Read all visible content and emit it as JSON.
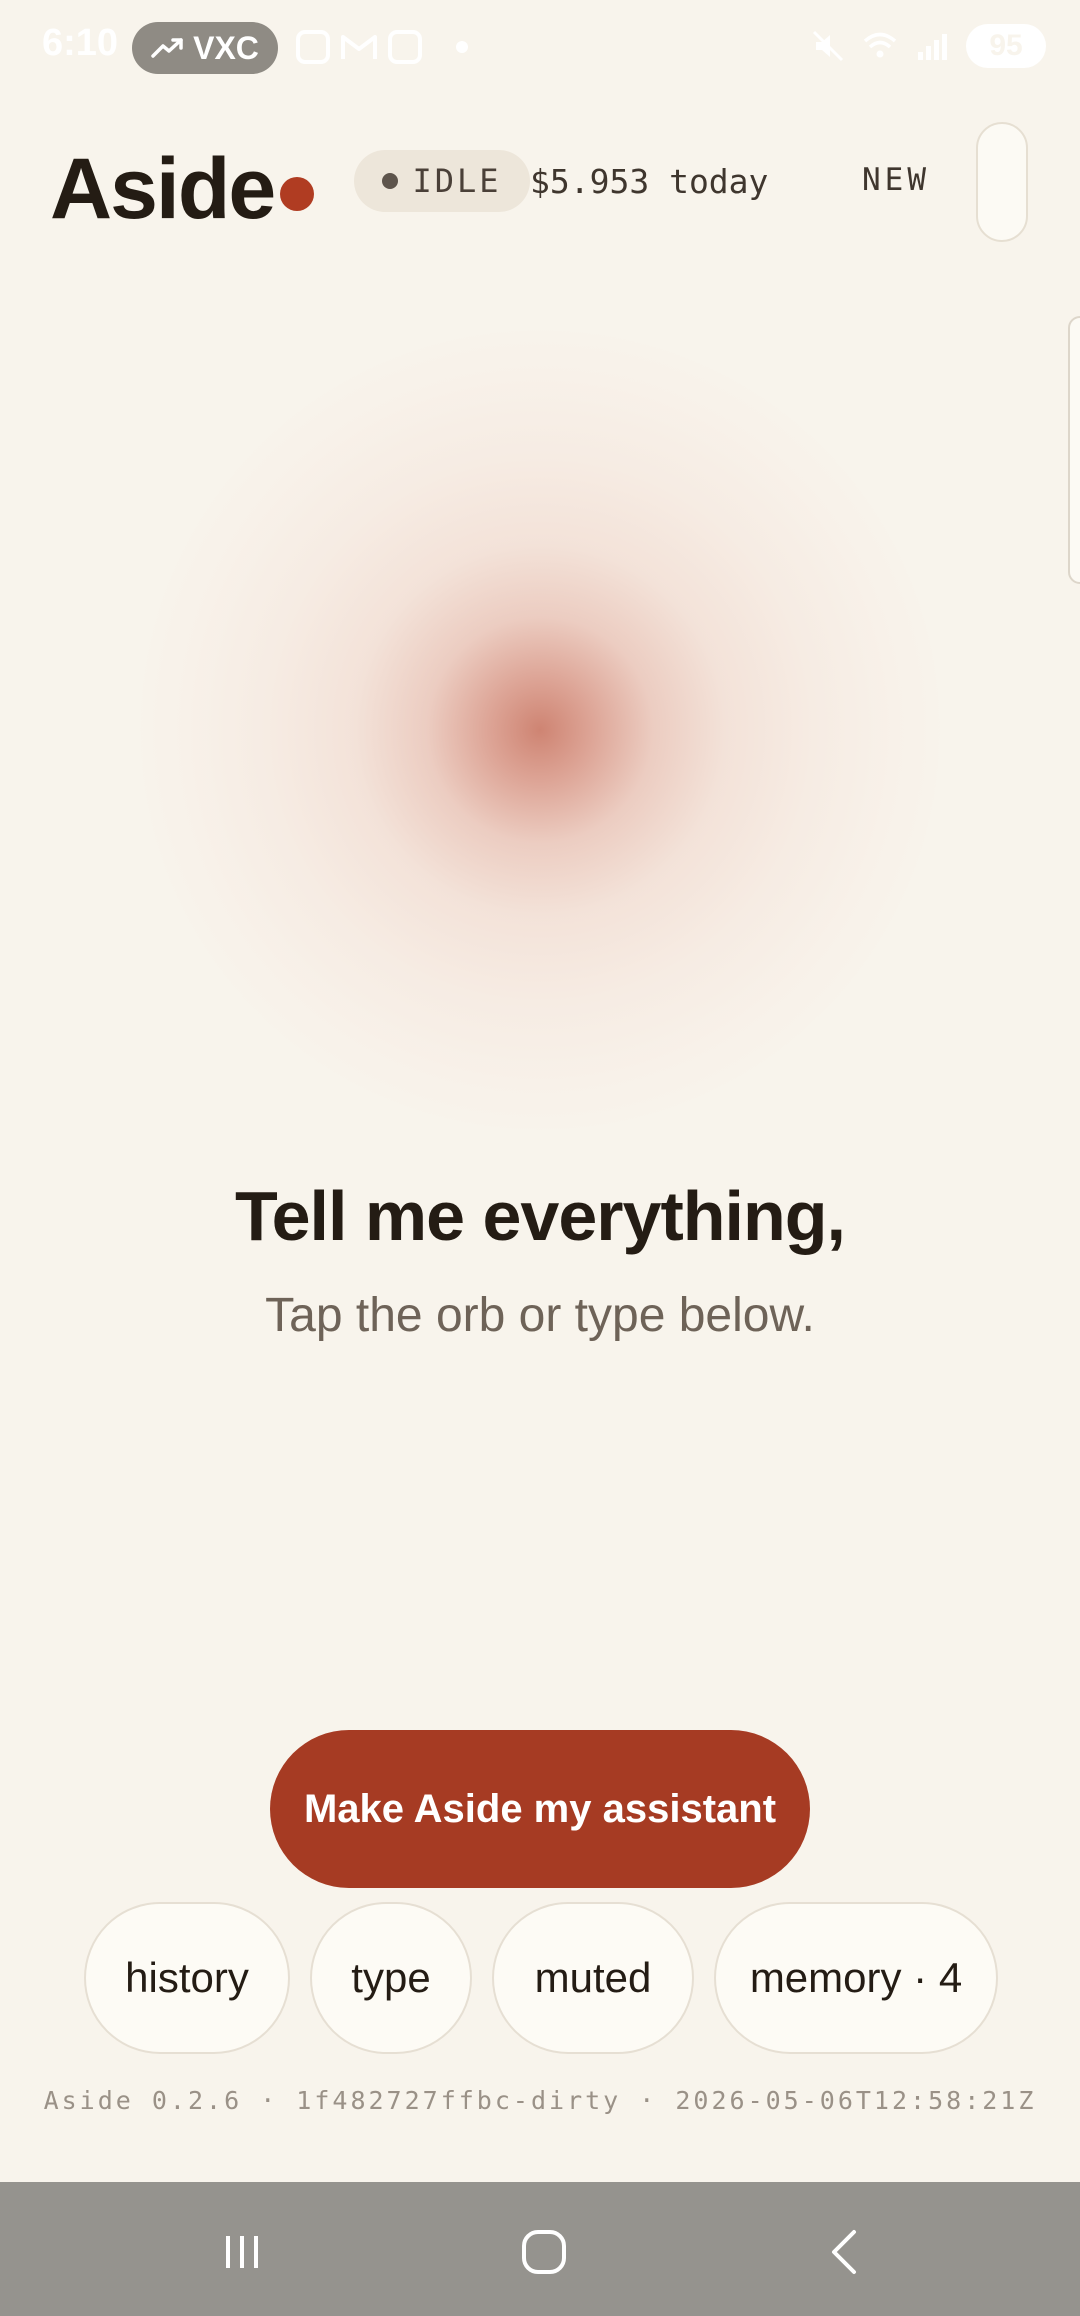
{
  "status_bar": {
    "time": "6:10",
    "pill_label": "VXC",
    "battery": "95",
    "icons": [
      "trend-up-icon",
      "instagram-icon",
      "gmail-icon",
      "instagram-icon",
      "notification-dot",
      "mute-icon",
      "wifi-icon",
      "signal-icon",
      "battery-charging-icon"
    ]
  },
  "header": {
    "logo": "Aside",
    "status": "IDLE",
    "cost": "$5.953 today",
    "new_label": "NEW"
  },
  "main": {
    "headline": "Tell me everything,",
    "subline": "Tap the orb or type below."
  },
  "cta": {
    "label": "Make Aside my assistant"
  },
  "pills": {
    "history": "history",
    "type": "type",
    "muted": "muted",
    "memory": "memory · 4"
  },
  "footer": {
    "build": "Aside 0.2.6 · 1f482727ffbc-dirty · 2026-05-06T12:58:21Z"
  },
  "nav": {
    "icons": [
      "recents-icon",
      "home-icon",
      "back-icon"
    ]
  },
  "colors": {
    "background": "#f8f4ec",
    "accent": "#a63b23",
    "logo_dot": "#b03c22",
    "text": "#241c14",
    "nav_bar": "#95938e"
  }
}
